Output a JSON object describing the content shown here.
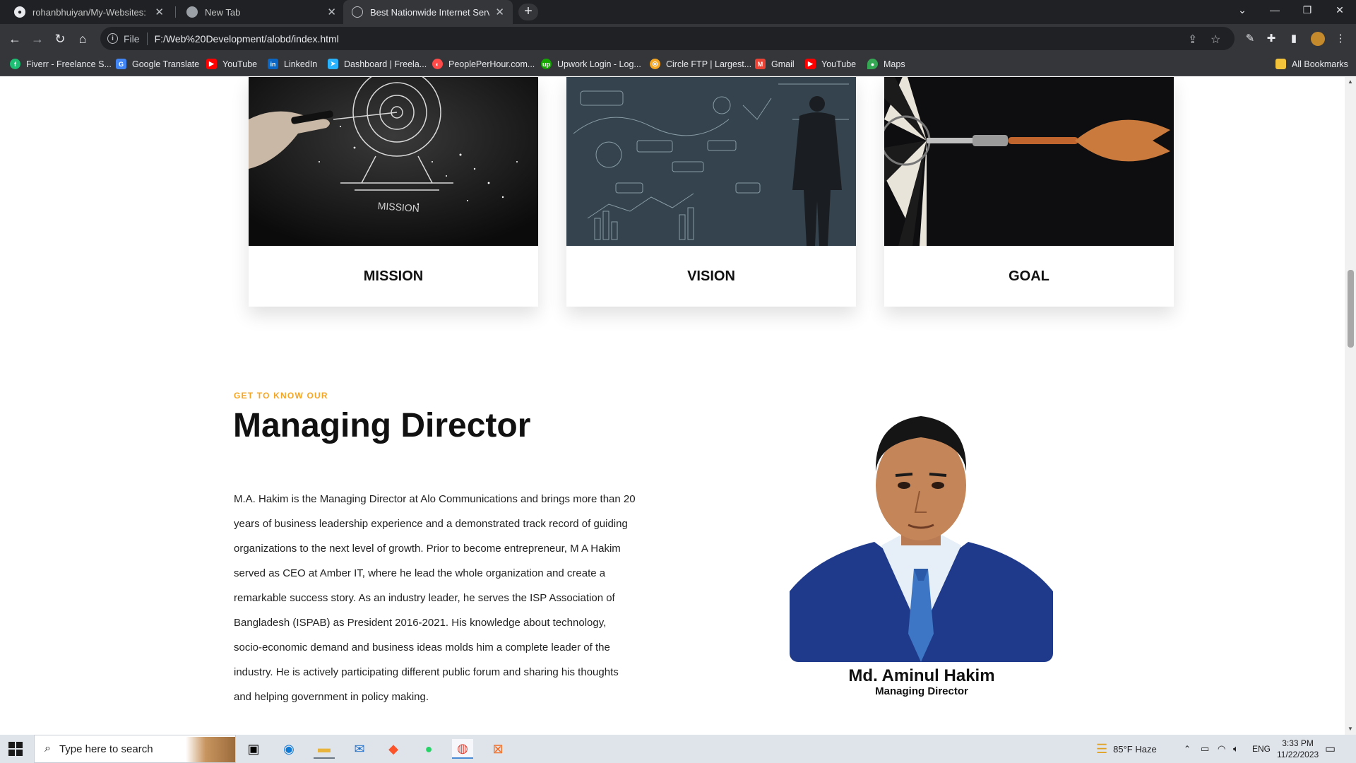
{
  "browser": {
    "tabs": [
      {
        "title": "rohanbhuiyan/My-Websites: I ha",
        "icon": "github-icon"
      },
      {
        "title": "New Tab",
        "icon": "chrome-icon"
      },
      {
        "title": "Best Nationwide Internet Service",
        "icon": "globe-icon"
      }
    ],
    "address": {
      "scheme_label": "File",
      "url": "F:/Web%20Development/alobd/index.html"
    },
    "bookmarks": [
      {
        "label": "Fiverr - Freelance S...",
        "icon": "fiverr-icon",
        "color": "#1dbf73"
      },
      {
        "label": "Google Translate",
        "icon": "translate-icon",
        "color": "#4285f4"
      },
      {
        "label": "YouTube",
        "icon": "youtube-icon",
        "color": "#ff0000"
      },
      {
        "label": "LinkedIn",
        "icon": "linkedin-icon",
        "color": "#0a66c2"
      },
      {
        "label": "Dashboard | Freela...",
        "icon": "freelancer-icon",
        "color": "#29b2fe"
      },
      {
        "label": "PeoplePerHour.com...",
        "icon": "peopleperhour-icon",
        "color": "#ff4a4a"
      },
      {
        "label": "Upwork Login - Log...",
        "icon": "upwork-icon",
        "color": "#14a800"
      },
      {
        "label": "Circle FTP | Largest...",
        "icon": "circleftp-icon",
        "color": "#f5a623"
      },
      {
        "label": "Gmail",
        "icon": "gmail-icon",
        "color": "#ea4335"
      },
      {
        "label": "YouTube",
        "icon": "youtube-icon",
        "color": "#ff0000"
      },
      {
        "label": "Maps",
        "icon": "maps-icon",
        "color": "#34a853"
      }
    ],
    "all_bookmarks": "All Bookmarks"
  },
  "page": {
    "cards": [
      {
        "title": "MISSION",
        "image_text": "MISSION"
      },
      {
        "title": "VISION"
      },
      {
        "title": "GOAL"
      }
    ],
    "md": {
      "eyebrow": "GET TO KNOW OUR",
      "heading": "Managing Director",
      "bio": "M.A. Hakim is the Managing Director at Alo Communications and brings more than 20 years of business leadership experience and a demonstrated track record of guiding organizations to the next level of growth. Prior to become entrepreneur, M A Hakim served as CEO at Amber IT, where he lead the whole organization and create a remarkable success story. As an industry leader, he serves the ISP Association of Bangladesh (ISPAB) as President 2016-2021. His knowledge about technology, socio-economic demand and business ideas molds him a complete leader of the industry. He is actively participating different public forum and sharing his thoughts and helping government in policy making.",
      "name": "Md. Aminul Hakim",
      "role": "Managing Director"
    }
  },
  "taskbar": {
    "search_placeholder": "Type here to search",
    "weather": "85°F  Haze",
    "language": "ENG",
    "time": "3:33 PM",
    "date": "11/22/2023"
  }
}
